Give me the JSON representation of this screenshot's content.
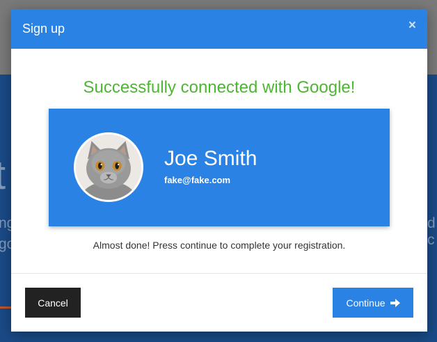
{
  "background": {
    "headline_fragment": "t",
    "line1_fragment": "ng",
    "line2_fragment": "go",
    "right_fragment": "d c"
  },
  "modal": {
    "title": "Sign up",
    "close_symbol": "×",
    "success_message": "Successfully connected with Google!",
    "profile": {
      "name": "Joe Smith",
      "email": "fake@fake.com",
      "avatar_icon": "cat-avatar-icon"
    },
    "note": "Almost done! Press continue to complete your registration.",
    "buttons": {
      "cancel": "Cancel",
      "continue": "Continue",
      "continue_icon": "arrow-right-icon"
    }
  },
  "colors": {
    "header_blue": "#2a82e4",
    "success_green": "#4db733",
    "cancel_dark": "#222222"
  }
}
